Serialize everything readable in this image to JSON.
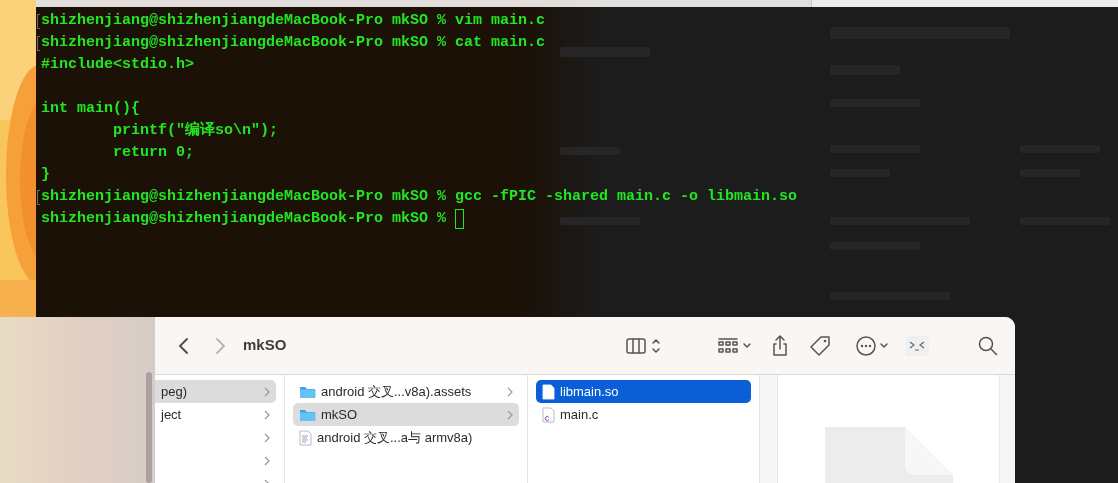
{
  "terminal": {
    "lines": [
      {
        "kind": "prompt",
        "marked": true,
        "prompt": "shizhenjiang@shizhenjiangdeMacBook-Pro mkSO %",
        "command": "vim main.c",
        "cursor": false
      },
      {
        "kind": "prompt",
        "marked": true,
        "prompt": "shizhenjiang@shizhenjiangdeMacBook-Pro mkSO %",
        "command": "cat main.c",
        "cursor": false
      },
      {
        "kind": "output",
        "text": "#include<stdio.h>"
      },
      {
        "kind": "blank"
      },
      {
        "kind": "output",
        "text": "int main(){"
      },
      {
        "kind": "output",
        "text": "        printf(\"编译so\\n\");"
      },
      {
        "kind": "output",
        "text": "        return 0;"
      },
      {
        "kind": "output",
        "text": "}"
      },
      {
        "kind": "prompt",
        "marked": true,
        "prompt": "shizhenjiang@shizhenjiangdeMacBook-Pro mkSO %",
        "command": "gcc -fPIC -shared main.c -o libmain.so",
        "cursor": false
      },
      {
        "kind": "prompt",
        "marked": false,
        "prompt": "shizhenjiang@shizhenjiangdeMacBook-Pro mkSO %",
        "cursor": true
      }
    ]
  },
  "finder": {
    "title": "mkSO",
    "back_enabled": true,
    "forward_enabled": false,
    "columns": [
      {
        "items": [
          {
            "name": "peg)",
            "kind": "folder-cut",
            "selected": true,
            "chevron": true
          },
          {
            "name": "ject",
            "kind": "folder-cut",
            "selected": false,
            "chevron": true
          },
          {
            "kind": "folder-cut",
            "selected": false,
            "chevron": true
          },
          {
            "kind": "folder-cut",
            "selected": false,
            "chevron": true
          },
          {
            "kind": "folder-cut",
            "selected": false,
            "chevron": true
          }
        ]
      },
      {
        "items": [
          {
            "name": "android 交叉...v8a).assets",
            "kind": "folder",
            "selected": false,
            "chevron": true
          },
          {
            "name": "mkSO",
            "kind": "folder",
            "selected": true,
            "chevron": true
          },
          {
            "name": "android 交叉...a与 armv8a)",
            "kind": "document",
            "selected": false,
            "chevron": false
          }
        ]
      },
      {
        "items": [
          {
            "name": "libmain.so",
            "kind": "blank-file",
            "selected": true,
            "active": true,
            "chevron": false
          },
          {
            "name": "main.c",
            "kind": "c-file",
            "selected": false,
            "active": false,
            "chevron": false
          }
        ]
      }
    ]
  }
}
